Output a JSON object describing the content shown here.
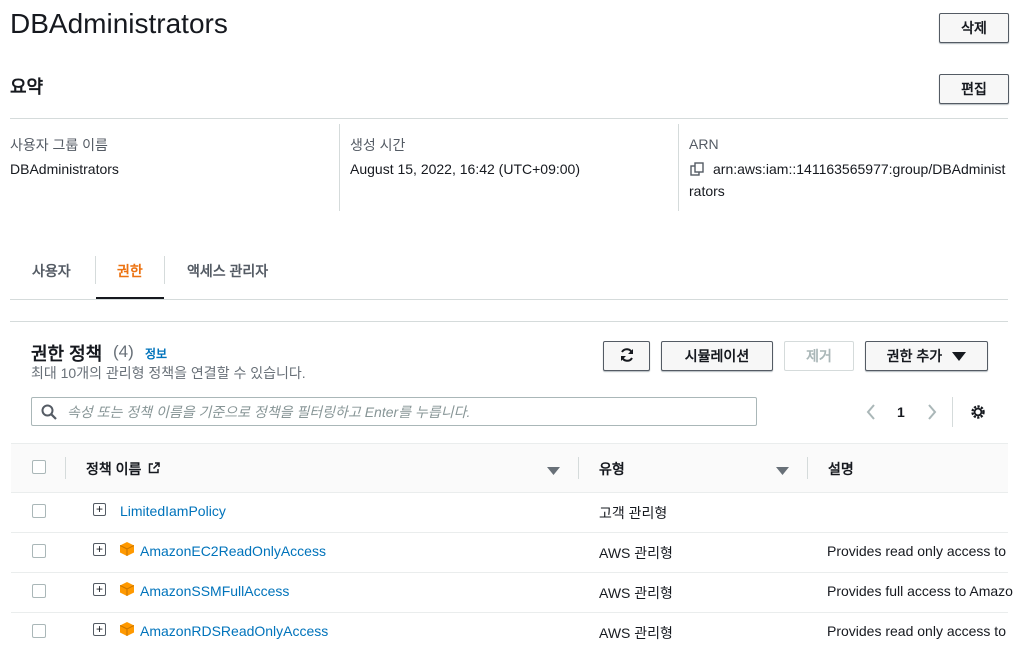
{
  "header": {
    "title": "DBAdministrators",
    "delete_label": "삭제"
  },
  "summary": {
    "heading": "요약",
    "edit_label": "편집",
    "group_name_label": "사용자 그룹 이름",
    "group_name_value": "DBAdministrators",
    "created_label": "생성 시간",
    "created_value": "August 15, 2022, 16:42 (UTC+09:00)",
    "arn_label": "ARN",
    "arn_line1": "arn:aws:iam::141163565977:group/DBAdminist",
    "arn_line2": "rators"
  },
  "tabs": [
    "사용자",
    "권한",
    "액세스 관리자"
  ],
  "permissions": {
    "heading": "권한 정책",
    "count": "(4)",
    "info_link": "정보",
    "description": "최대 10개의 관리형 정책을 연결할 수 있습니다.",
    "simulate_label": "시뮬레이션",
    "remove_label": "제거",
    "add_label": "권한 추가",
    "search_placeholder": "속성 또는 정책 이름을 기준으로 정책을 필터링하고 Enter를 누릅니다.",
    "page_number": "1",
    "columns": {
      "name": "정책 이름",
      "type": "유형",
      "description": "설명"
    },
    "rows": [
      {
        "name": "LimitedIamPolicy",
        "type": "고객 관리형",
        "description": ""
      },
      {
        "name": "AmazonEC2ReadOnlyAccess",
        "type": "AWS 관리형",
        "description": "Provides read only access to"
      },
      {
        "name": "AmazonSSMFullAccess",
        "type": "AWS 관리형",
        "description": "Provides full access to Amazo"
      },
      {
        "name": "AmazonRDSReadOnlyAccess",
        "type": "AWS 관리형",
        "description": "Provides read only access to"
      }
    ]
  },
  "colors": {
    "link": "#0073bb",
    "active_tab": "#ec7211",
    "aws_cube": "#f90"
  }
}
